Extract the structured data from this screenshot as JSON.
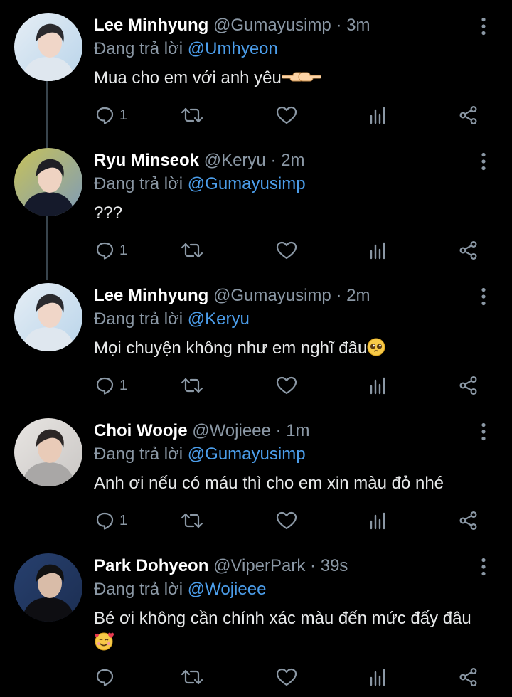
{
  "reply_prefix": "Đang trả lời",
  "tweets": [
    {
      "name": "Lee Minhyung",
      "handle": "@Gumayusimp",
      "time": "3m",
      "reply_to": "@Umhyeon",
      "text": "Mua cho em với anh yêu",
      "emoji": "pointing-hands-emoji",
      "reply_count": "1",
      "avatar": "avatar-light"
    },
    {
      "name": "Ryu Minseok",
      "handle": "@Keryu",
      "time": "2m",
      "reply_to": "@Gumayusimp",
      "text": "???",
      "emoji": "",
      "reply_count": "1",
      "avatar": "avatar-dark-outdoor"
    },
    {
      "name": "Lee Minhyung",
      "handle": "@Gumayusimp",
      "time": "2m",
      "reply_to": "@Keryu",
      "text": "Mọi chuyện không như em nghĩ đâu",
      "emoji": "pleading-face-emoji",
      "reply_count": "1",
      "avatar": "avatar-light"
    },
    {
      "name": "Choi Wooje",
      "handle": "@Wojieee",
      "time": "1m",
      "reply_to": "@Gumayusimp",
      "text": "Anh ơi nếu có máu thì cho em xin màu đỏ nhé",
      "emoji": "",
      "reply_count": "1",
      "avatar": "avatar-grey"
    },
    {
      "name": "Park Dohyeon",
      "handle": "@ViperPark",
      "time": "39s",
      "reply_to": "@Wojieee",
      "text": "Bé ơi không cần chính xác màu đến mức đấy đâu",
      "emoji": "smiling-hearts-emoji",
      "reply_count": "",
      "avatar": "avatar-navy"
    }
  ],
  "colors": {
    "background": "#000000",
    "name": "#ffffff",
    "muted": "#8b98a5",
    "link": "#4c9eeb",
    "body_text": "#e7e9ea"
  }
}
